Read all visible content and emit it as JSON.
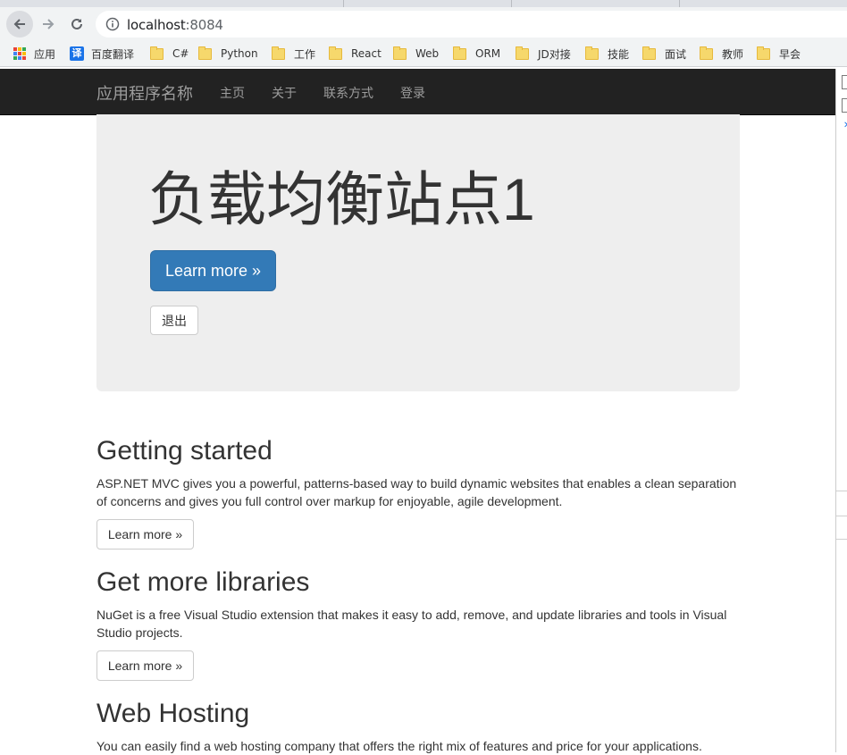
{
  "browser": {
    "url_host": "localhost",
    "url_port": ":8084",
    "bookmarks": [
      {
        "label": "应用",
        "type": "apps"
      },
      {
        "label": "百度翻译",
        "type": "fanyi"
      },
      {
        "label": "C#",
        "type": "folder"
      },
      {
        "label": "Python",
        "type": "folder"
      },
      {
        "label": "工作",
        "type": "folder"
      },
      {
        "label": "React",
        "type": "folder"
      },
      {
        "label": "Web",
        "type": "folder"
      },
      {
        "label": "ORM",
        "type": "folder"
      },
      {
        "label": "JD对接",
        "type": "folder"
      },
      {
        "label": "技能",
        "type": "folder"
      },
      {
        "label": "面试",
        "type": "folder"
      },
      {
        "label": "教师",
        "type": "folder"
      },
      {
        "label": "早会",
        "type": "folder"
      }
    ]
  },
  "navbar": {
    "brand": "应用程序名称",
    "links": [
      "主页",
      "关于",
      "联系方式",
      "登录"
    ]
  },
  "jumbotron": {
    "title": "负载均衡站点1",
    "primary_button": "Learn more »",
    "logout_button": "退出"
  },
  "sections": [
    {
      "heading": "Getting started",
      "text": "ASP.NET MVC gives you a powerful, patterns-based way to build dynamic websites that enables a clean separation of concerns and gives you full control over markup for enjoyable, agile development.",
      "button": "Learn more »"
    },
    {
      "heading": "Get more libraries",
      "text": "NuGet is a free Visual Studio extension that makes it easy to add, remove, and update libraries and tools in Visual Studio projects.",
      "button": "Learn more »"
    },
    {
      "heading": "Web Hosting",
      "text": "You can easily find a web hosting company that offers the right mix of features and price for your applications."
    }
  ],
  "colors": {
    "navbar_bg": "#222222",
    "primary": "#337ab7",
    "jumbotron_bg": "#eeeeee"
  }
}
